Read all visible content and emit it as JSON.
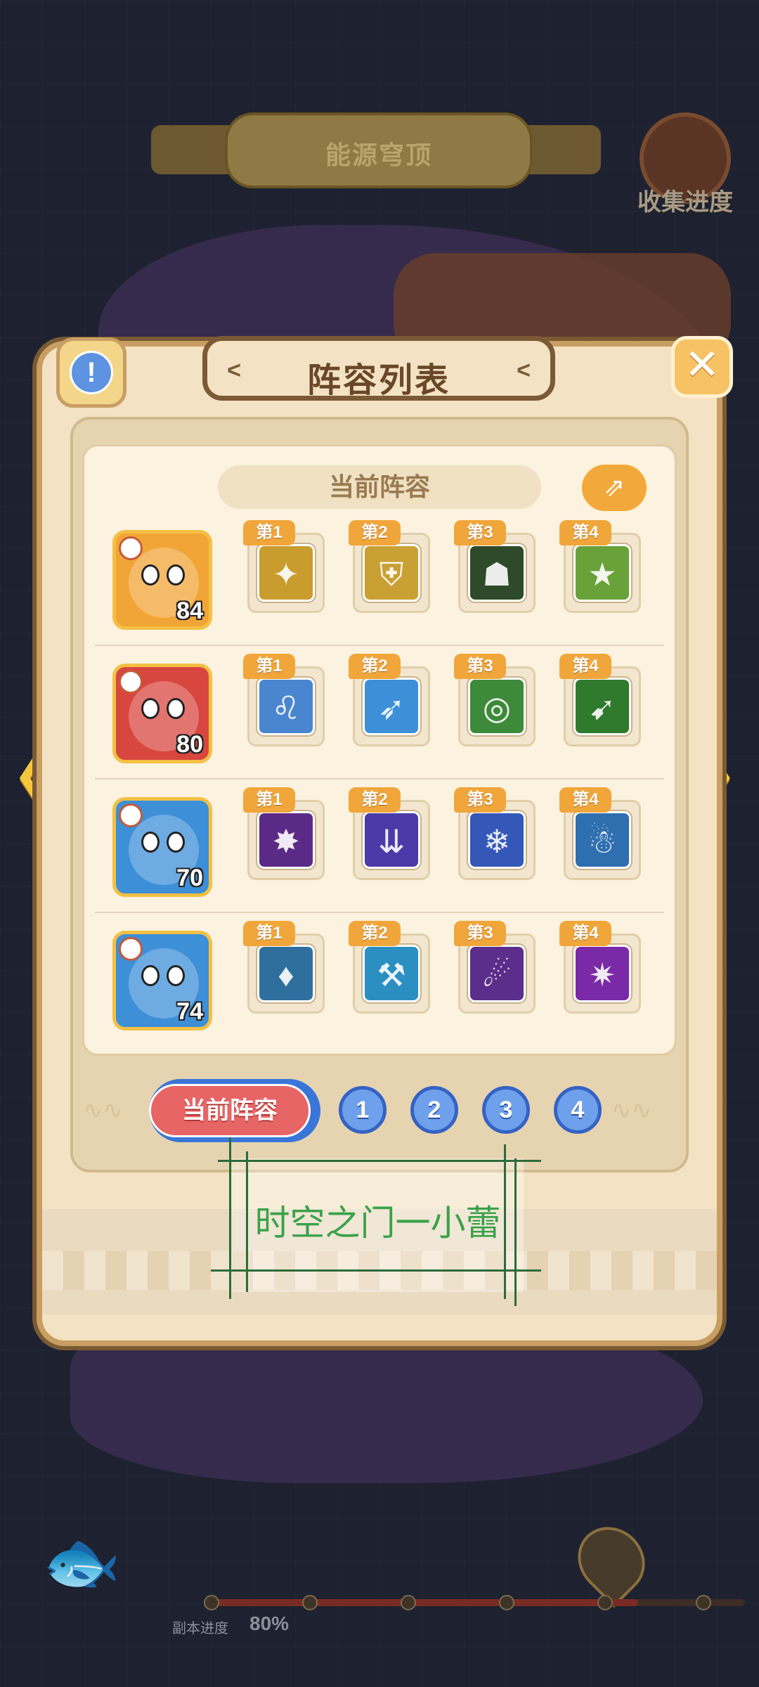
{
  "stage": {
    "title": "能源穹顶"
  },
  "collect": {
    "label": "收集进度"
  },
  "panel": {
    "title": "阵容列表",
    "current_label": "当前阵容",
    "share_icon": "share-icon",
    "info_icon": "info-icon",
    "close_icon": "close-icon"
  },
  "lineups": [
    {
      "hero_level": "84",
      "hero_color": "#f2a537",
      "skills": [
        {
          "tag": "第1",
          "icon": "shadow-claw",
          "color": "#c99c2e",
          "glyph": "✦"
        },
        {
          "tag": "第2",
          "icon": "gold-shield",
          "color": "#c9a034",
          "glyph": "⛨"
        },
        {
          "tag": "第3",
          "icon": "dark-beast",
          "color": "#2f4a2a",
          "glyph": "☗"
        },
        {
          "tag": "第4",
          "icon": "star-shield",
          "color": "#6aa23a",
          "glyph": "★"
        }
      ]
    },
    {
      "hero_level": "80",
      "hero_color": "#d8473f",
      "skills": [
        {
          "tag": "第1",
          "icon": "lion-warrior",
          "color": "#4a86d0",
          "glyph": "♌"
        },
        {
          "tag": "第2",
          "icon": "spear-strike",
          "color": "#3d8fd8",
          "glyph": "➶"
        },
        {
          "tag": "第3",
          "icon": "target-lock",
          "color": "#3d8a3a",
          "glyph": "◎"
        },
        {
          "tag": "第4",
          "icon": "green-arrow",
          "color": "#2f7a2c",
          "glyph": "➹"
        }
      ]
    },
    {
      "hero_level": "70",
      "hero_color": "#3d8fd8",
      "skills": [
        {
          "tag": "第1",
          "icon": "purple-burst",
          "color": "#5b2a86",
          "glyph": "✸"
        },
        {
          "tag": "第2",
          "icon": "arrow-rain",
          "color": "#4b3aa8",
          "glyph": "⇊"
        },
        {
          "tag": "第3",
          "icon": "ice-shards",
          "color": "#3457b8",
          "glyph": "❄"
        },
        {
          "tag": "第4",
          "icon": "golem-spirit",
          "color": "#2e6fb0",
          "glyph": "☃"
        }
      ]
    },
    {
      "hero_level": "74",
      "hero_color": "#3d8fd8",
      "skills": [
        {
          "tag": "第1",
          "icon": "red-mask",
          "color": "#2f6f9e",
          "glyph": "♦"
        },
        {
          "tag": "第2",
          "icon": "ice-hammer",
          "color": "#2b8fc2",
          "glyph": "⚒"
        },
        {
          "tag": "第3",
          "icon": "void-vortex",
          "color": "#5a2e8a",
          "glyph": "☄"
        },
        {
          "tag": "第4",
          "icon": "arcane-star",
          "color": "#7a2aa6",
          "glyph": "✷"
        }
      ]
    }
  ],
  "tabs": {
    "current": "当前阵容",
    "numbers": [
      "1",
      "2",
      "3",
      "4"
    ]
  },
  "stamp": {
    "text": "时空之门一小蕾"
  },
  "progress": {
    "label": "副本进度",
    "value": "80%",
    "fraction": 0.8
  }
}
